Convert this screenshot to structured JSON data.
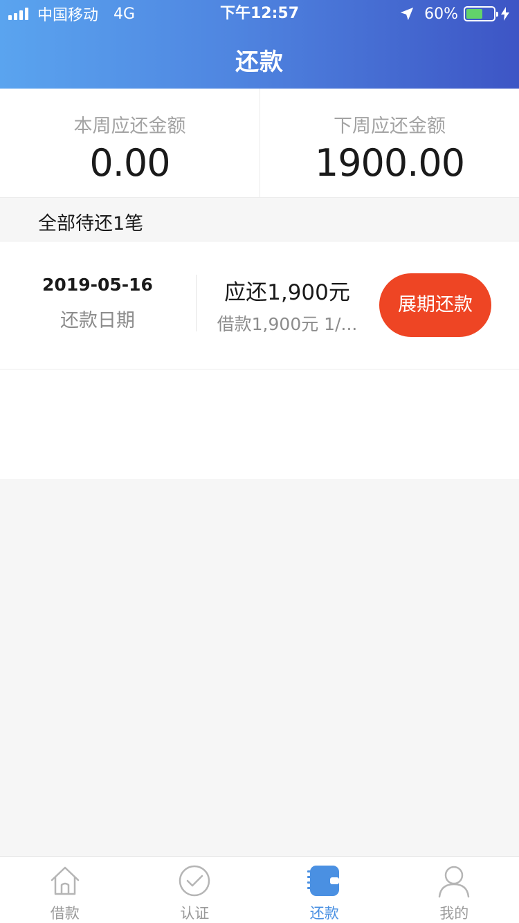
{
  "status_bar": {
    "carrier": "中国移动",
    "network": "4G",
    "time": "下午12:57",
    "battery": "60%",
    "battery_level": 0.6
  },
  "header": {
    "title": "还款"
  },
  "summary": {
    "this_week_label": "本周应还金额",
    "this_week_value": "0.00",
    "next_week_label": "下周应还金额",
    "next_week_value": "1900.00"
  },
  "section": {
    "title": "全部待还1笔"
  },
  "items": [
    {
      "date": "2019-05-16",
      "date_label": "还款日期",
      "due": "应还1,900元",
      "loan": "借款1,900元 1/...",
      "button": "展期还款"
    }
  ],
  "tabbar": {
    "active": "repay",
    "tabs": [
      {
        "id": "borrow",
        "label": "借款",
        "icon": "home-icon"
      },
      {
        "id": "verify",
        "label": "认证",
        "icon": "check-circle-icon"
      },
      {
        "id": "repay",
        "label": "还款",
        "icon": "wallet-icon"
      },
      {
        "id": "mine",
        "label": "我的",
        "icon": "user-icon"
      }
    ]
  },
  "colors": {
    "header_start": "#5aa4ef",
    "header_end": "#3d55c5",
    "accent_button": "#ee4524",
    "active_tab": "#4a90e2"
  }
}
